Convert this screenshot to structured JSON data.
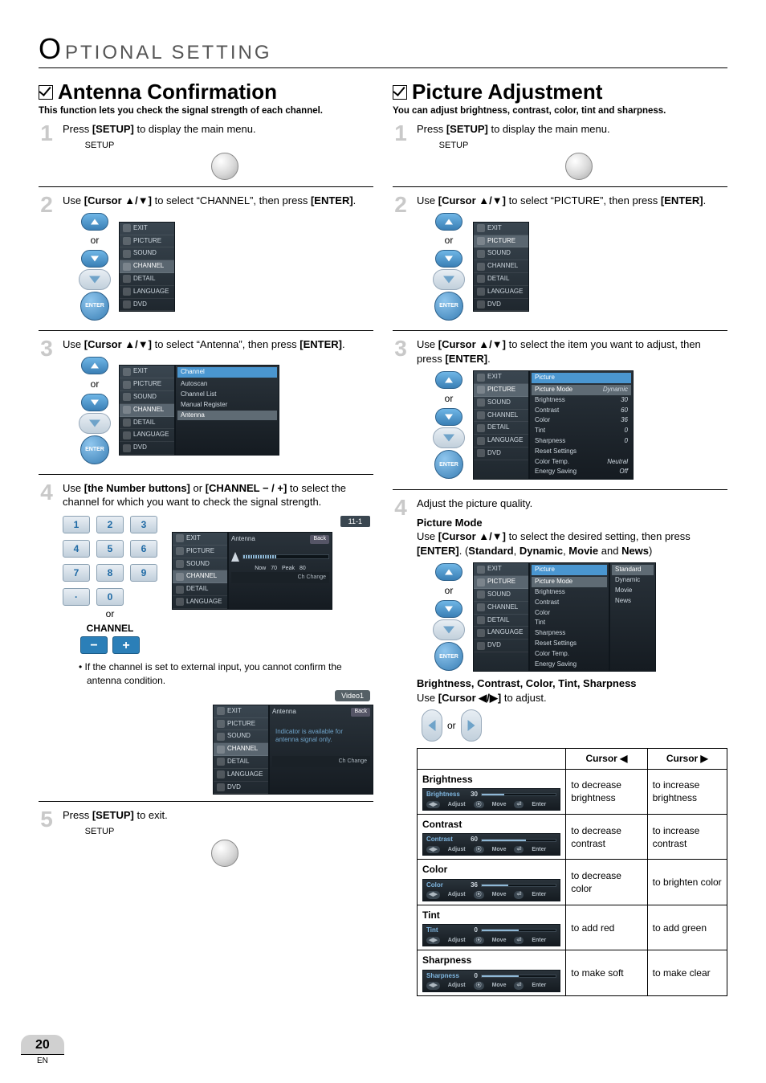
{
  "page": {
    "number": "20",
    "lang": "EN",
    "header_rest": "PTIONAL   SETTING"
  },
  "common": {
    "setup_label": "SETUP",
    "or": "or",
    "enter": "ENTER",
    "channel_label": "CHANNEL",
    "cursor_updown_prefix": "Use ",
    "cursor_updown_bold": "[Cursor ",
    "cursor_leftright_bold": "[Cursor "
  },
  "osd_menu_items": {
    "exit": "EXIT",
    "picture": "PICTURE",
    "sound": "SOUND",
    "channel": "CHANNEL",
    "detail": "DETAIL",
    "language": "LANGUAGE",
    "dvd": "DVD"
  },
  "left": {
    "title": "Antenna Confirmation",
    "subtitle": "This function lets you check the signal strength of each channel.",
    "step1": {
      "pre": "Press ",
      "bold": "[SETUP]",
      "post": " to display the main menu."
    },
    "step2": {
      "pre": "Use ",
      "bold": "[Cursor ▲/▼]",
      "mid": " to select “CHANNEL”, then press ",
      "bold2": "[ENTER]",
      "post": "."
    },
    "channel_panel": {
      "header": "Channel",
      "items": [
        "Autoscan",
        "Channel List",
        "Manual Register",
        "Antenna"
      ]
    },
    "step3": {
      "pre": "Use ",
      "bold": "[Cursor ▲/▼]",
      "mid": " to select “Antenna”, then press ",
      "bold2": "[ENTER]",
      "post": "."
    },
    "step4": {
      "pre": "Use ",
      "bold1": "[the Number buttons]",
      "mid1": " or ",
      "bold2": "[CHANNEL − / +]",
      "post": " to select the channel for which you want to check the signal strength."
    },
    "chip_channel": "11-1",
    "antenna_panel": {
      "title": "Antenna",
      "back": "Back",
      "now": "Now",
      "now_val": "70",
      "peak": "Peak",
      "peak_val": "80",
      "footer": "Ch Change"
    },
    "note": "If the channel is set to external input, you cannot confirm the antenna condition.",
    "video_chip": "Video1",
    "ext_panel_text": "Indicator is available for antenna signal only.",
    "step5": {
      "pre": "Press ",
      "bold": "[SETUP]",
      "post": " to exit."
    },
    "numkeys": [
      "1",
      "2",
      "3",
      "4",
      "5",
      "6",
      "7",
      "8",
      "9",
      "·",
      "0"
    ],
    "minus": "−",
    "plus": "+"
  },
  "right": {
    "title": "Picture Adjustment",
    "subtitle": "You can adjust brightness, contrast, color, tint and sharpness.",
    "step1": {
      "pre": "Press ",
      "bold": "[SETUP]",
      "post": " to display the main menu."
    },
    "step2": {
      "pre": "Use ",
      "bold": "[Cursor ▲/▼]",
      "mid": " to select “PICTURE”, then press ",
      "bold2": "[ENTER]",
      "post": "."
    },
    "step3": {
      "pre": "Use ",
      "bold": "[Cursor ▲/▼]",
      "mid": " to select the item you want to adjust, then press ",
      "bold2": "[ENTER]",
      "post": "."
    },
    "picture_panel": {
      "header": "Picture",
      "rows": [
        {
          "k": "Picture Mode",
          "v": "Dynamic"
        },
        {
          "k": "Brightness",
          "v": "30"
        },
        {
          "k": "Contrast",
          "v": "60"
        },
        {
          "k": "Color",
          "v": "36"
        },
        {
          "k": "Tint",
          "v": "0"
        },
        {
          "k": "Sharpness",
          "v": "0"
        },
        {
          "k": "Reset Settings",
          "v": ""
        },
        {
          "k": "Color Temp.",
          "v": "Neutral"
        },
        {
          "k": "Energy Saving",
          "v": "Off"
        }
      ]
    },
    "step4_intro": "Adjust the picture quality.",
    "picture_mode": {
      "title": "Picture Mode",
      "line_pre": "Use ",
      "line_bold": "[Cursor ▲/▼]",
      "line_mid": " to select the desired setting, then press ",
      "line_bold2": "[ENTER]",
      "line_post": ". (",
      "opts": [
        "Standard",
        "Dynamic",
        "Movie",
        "News"
      ],
      "and": " and ",
      "close": ")"
    },
    "picture_mode_panel": {
      "header": "Picture",
      "left_rows": [
        "Picture Mode",
        "Brightness",
        "Contrast",
        "Color",
        "Tint",
        "Sharpness",
        "Reset Settings",
        "Color Temp.",
        "Energy Saving"
      ],
      "right_opts": [
        "Standard",
        "Dynamic",
        "Movie",
        "News"
      ]
    },
    "bcts_title": "Brightness, Contrast, Color, Tint, Sharpness",
    "bcts_line_pre": "Use ",
    "bcts_line_bold": "[Cursor ◀/▶]",
    "bcts_line_post": " to adjust.",
    "table": {
      "h_left": "Cursor ◀",
      "h_right": "Cursor ▶",
      "rows": [
        {
          "name": "Brightness",
          "val": "30",
          "fill": 30,
          "left": "to decrease brightness",
          "right": "to increase brightness"
        },
        {
          "name": "Contrast",
          "val": "60",
          "fill": 60,
          "left": "to decrease contrast",
          "right": "to increase contrast"
        },
        {
          "name": "Color",
          "val": "36",
          "fill": 36,
          "left": "to decrease color",
          "right": "to brighten color"
        },
        {
          "name": "Tint",
          "val": "0",
          "fill": 50,
          "left": "to add red",
          "right": "to add green"
        },
        {
          "name": "Sharpness",
          "val": "0",
          "fill": 50,
          "left": "to make soft",
          "right": "to make clear"
        }
      ],
      "slider_foot": {
        "adjust": "Adjust",
        "move": "Move",
        "enter": "Enter"
      }
    }
  }
}
